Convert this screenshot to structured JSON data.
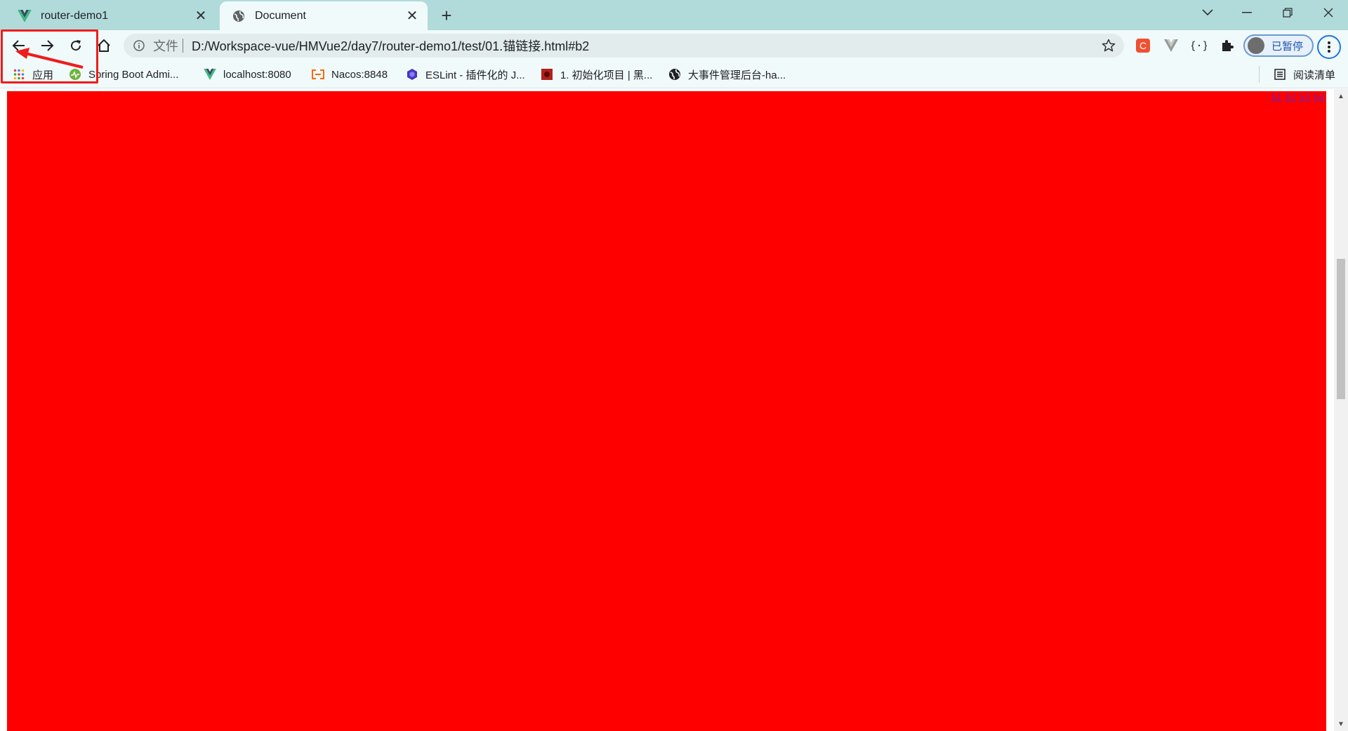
{
  "tabs": [
    {
      "title": "router-demo1",
      "icon": "vue-logo-icon",
      "active": false
    },
    {
      "title": "Document",
      "icon": "globe-icon",
      "active": true
    }
  ],
  "new_tab_label": "+",
  "window_controls": [
    "tab-search-icon",
    "minimize-icon",
    "restore-icon",
    "close-icon"
  ],
  "omnibox": {
    "label": "文件",
    "url": "D:/Workspace-vue/HMVue2/day7/router-demo1/test/01.锚链接.html#b2"
  },
  "profile": {
    "status": "已暂停"
  },
  "bookmarks": [
    {
      "label": "应用",
      "icon": "apps-grid-icon"
    },
    {
      "label": "Spring Boot Admi...",
      "icon": "heartbeat-icon"
    },
    {
      "label": "localhost:8080",
      "icon": "vue-logo-icon"
    },
    {
      "label": "Nacos:8848",
      "icon": "bracket-icon"
    },
    {
      "label": "ESLint - 插件化的 J...",
      "icon": "eslint-icon"
    },
    {
      "label": "1. 初始化项目 | 黑...",
      "icon": "red-square-icon"
    },
    {
      "label": "大事件管理后台-ha...",
      "icon": "globe-icon"
    }
  ],
  "reading_list": "阅读清单",
  "page": {
    "background_color": "#ff0000",
    "anchor_links": [
      "b1",
      "b2",
      "b3",
      "b4"
    ]
  },
  "colors": {
    "tab_strip": "#b1dbdb",
    "toolbar": "#f1fafa",
    "annotation": "#ee1c1c"
  }
}
